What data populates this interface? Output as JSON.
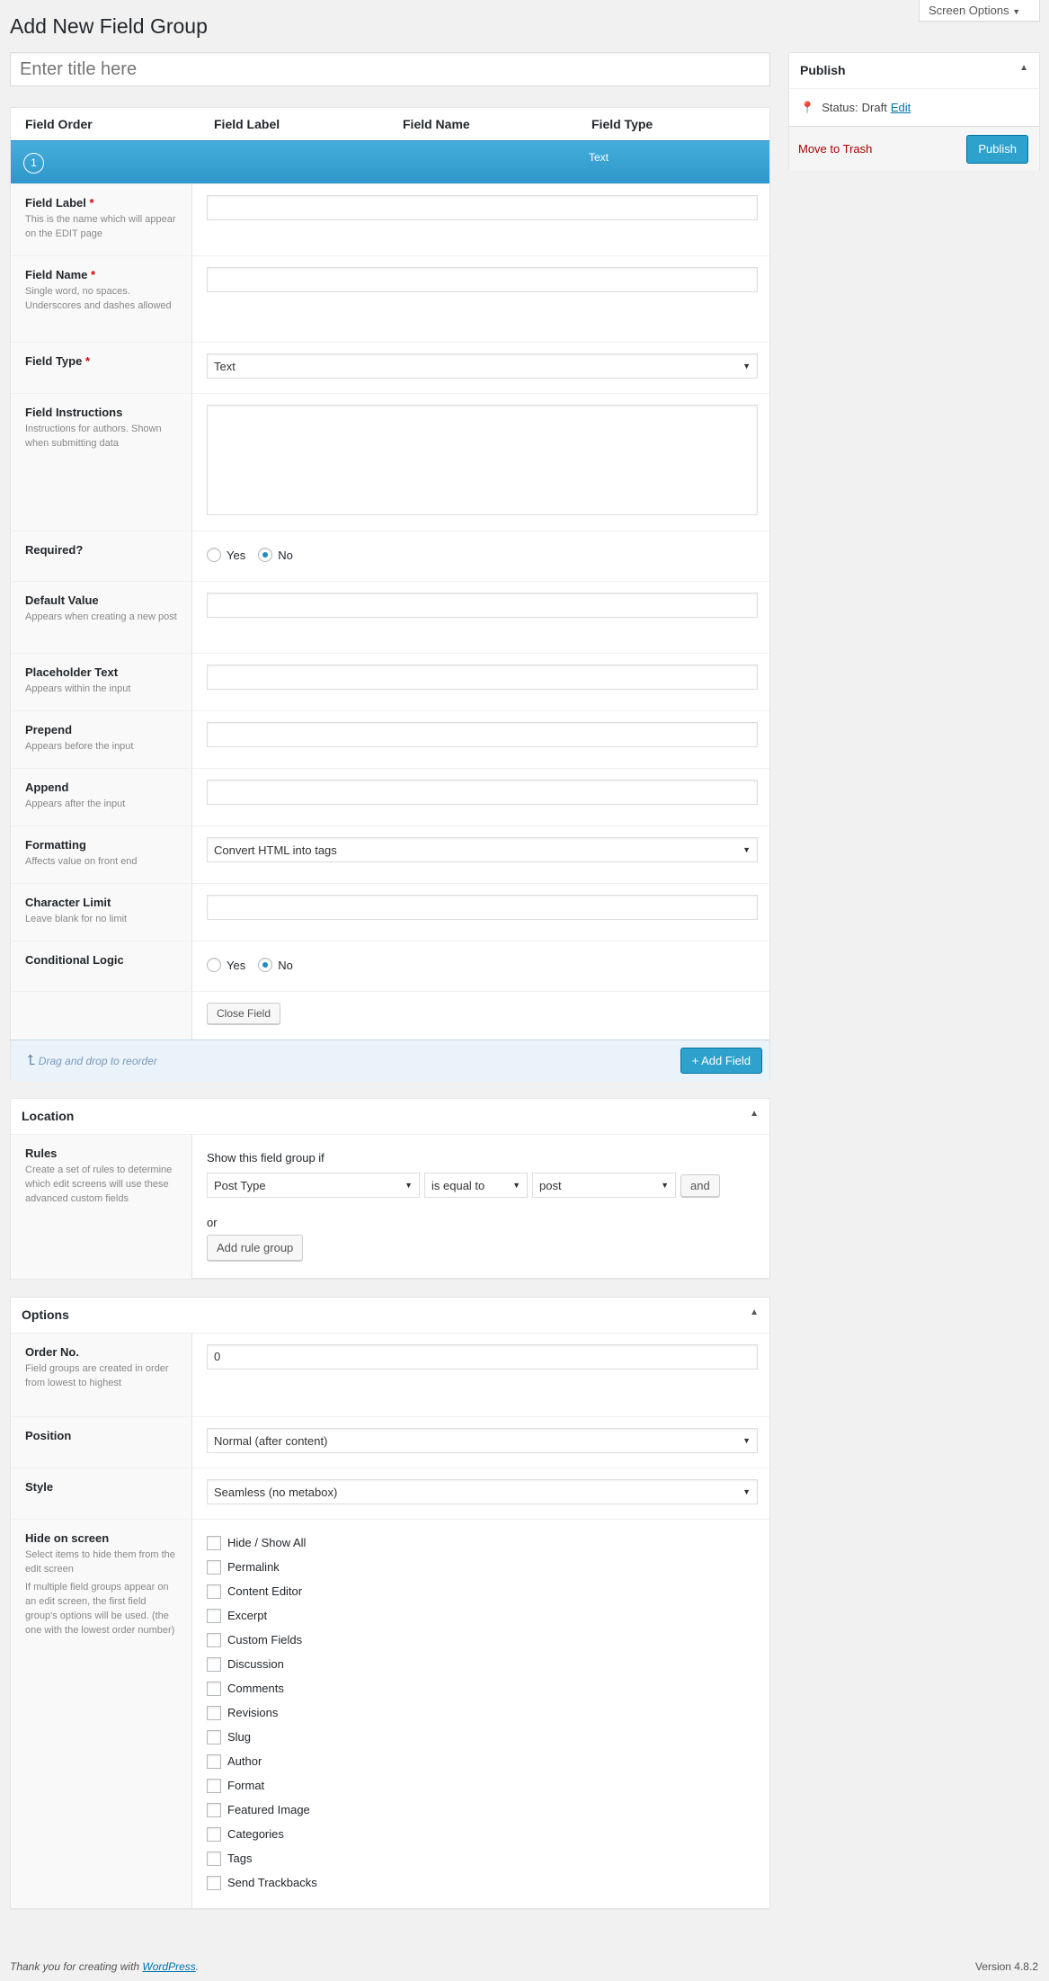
{
  "screen_options": "Screen Options",
  "page_title": "Add New Field Group",
  "title_placeholder": "Enter title here",
  "publish": {
    "title": "Publish",
    "status_label": "Status:",
    "status_value": "Draft",
    "edit": "Edit",
    "trash": "Move to Trash",
    "button": "Publish"
  },
  "fields_table": {
    "headers": [
      "Field Order",
      "Field Label",
      "Field Name",
      "Field Type"
    ],
    "field": {
      "order": "1",
      "type": "Text"
    }
  },
  "field_form": {
    "label": {
      "title": "Field Label",
      "req": "*",
      "desc": "This is the name which will appear on the EDIT page"
    },
    "name": {
      "title": "Field Name",
      "req": "*",
      "desc": "Single word, no spaces. Underscores and dashes allowed"
    },
    "type": {
      "title": "Field Type",
      "req": "*",
      "value": "Text"
    },
    "instructions": {
      "title": "Field Instructions",
      "desc": "Instructions for authors. Shown when submitting data"
    },
    "required": {
      "title": "Required?",
      "yes": "Yes",
      "no": "No"
    },
    "default": {
      "title": "Default Value",
      "desc": "Appears when creating a new post"
    },
    "placeholder": {
      "title": "Placeholder Text",
      "desc": "Appears within the input"
    },
    "prepend": {
      "title": "Prepend",
      "desc": "Appears before the input"
    },
    "append": {
      "title": "Append",
      "desc": "Appears after the input"
    },
    "formatting": {
      "title": "Formatting",
      "desc": "Affects value on front end",
      "value": "Convert HTML into tags"
    },
    "charlimit": {
      "title": "Character Limit",
      "desc": "Leave blank for no limit"
    },
    "conditional": {
      "title": "Conditional Logic",
      "yes": "Yes",
      "no": "No"
    },
    "close": "Close Field"
  },
  "fields_footer": {
    "hint": "Drag and drop to reorder",
    "add": "+ Add Field"
  },
  "location": {
    "title": "Location",
    "rules_title": "Rules",
    "rules_desc": "Create a set of rules to determine which edit screens will use these advanced custom fields",
    "show_if": "Show this field group if",
    "param": "Post Type",
    "operator": "is equal to",
    "value": "post",
    "and": "and",
    "or": "or",
    "add_group": "Add rule group"
  },
  "options": {
    "title": "Options",
    "order": {
      "title": "Order No.",
      "desc": "Field groups are created in order\nfrom lowest to highest",
      "value": "0"
    },
    "position": {
      "title": "Position",
      "value": "Normal (after content)"
    },
    "style": {
      "title": "Style",
      "value": "Seamless (no metabox)"
    },
    "hide": {
      "title": "Hide on screen",
      "desc1": "Select items to hide them from the edit screen",
      "desc2": "If multiple field groups appear on an edit screen, the first field group's options will be used. (the one with the lowest order number)",
      "items": [
        "Hide / Show All",
        "Permalink",
        "Content Editor",
        "Excerpt",
        "Custom Fields",
        "Discussion",
        "Comments",
        "Revisions",
        "Slug",
        "Author",
        "Format",
        "Featured Image",
        "Categories",
        "Tags",
        "Send Trackbacks"
      ]
    }
  },
  "footer": {
    "thanks": "Thank you for creating with ",
    "wp": "WordPress",
    "dot": ".",
    "version": "Version 4.8.2"
  }
}
